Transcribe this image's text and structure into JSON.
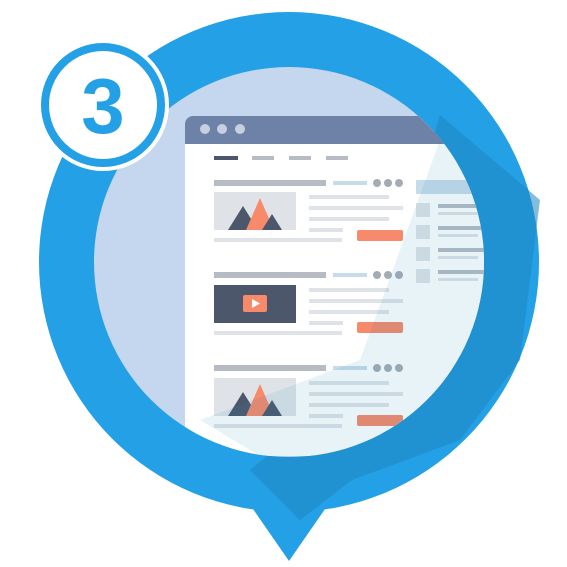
{
  "badge": {
    "step_number": "3"
  },
  "icon_names": {
    "pin": "location-pin-icon",
    "window_controls": "window-dots-icon",
    "image_placeholder": "mountain-image-icon",
    "video_placeholder": "play-video-icon"
  },
  "colors": {
    "pin_blue": "#23a0e6",
    "pin_shadow": "#1f85bf",
    "inner_bg": "#c5d6ef",
    "browser_header": "#6d82a6",
    "page_white": "#ffffff",
    "accent_orange": "#f78a6a",
    "dark_slate": "#4d576b",
    "muted_gray": "#b7bcc4",
    "light_gray": "#dfe3e8",
    "light_blue": "#c7dcea"
  }
}
